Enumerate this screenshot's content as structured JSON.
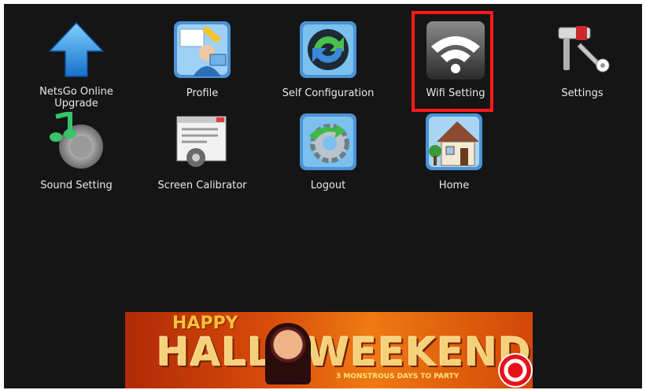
{
  "apps": [
    {
      "label": "NetsGo Online Upgrade",
      "icon": "upload-arrow-icon"
    },
    {
      "label": "Profile",
      "icon": "profile-icon"
    },
    {
      "label": "Self Configuration",
      "icon": "sync-icon"
    },
    {
      "label": "Wifi Setting",
      "icon": "wifi-icon"
    },
    {
      "label": "Settings",
      "icon": "tools-icon"
    },
    {
      "label": "Sound Setting",
      "icon": "speaker-icon"
    },
    {
      "label": "Screen Calibrator",
      "icon": "calibrator-icon"
    },
    {
      "label": "Logout",
      "icon": "logout-gear-icon"
    },
    {
      "label": "Home",
      "icon": "house-icon"
    }
  ],
  "highlighted_app": "Wifi Setting",
  "colors": {
    "background": "#151515",
    "highlight": "#ff1a1a",
    "label_text": "#e9e9e9"
  },
  "banner": {
    "happy": "HAPPY",
    "title": "HALLOWEEKEND",
    "subtitle": "3 MONSTROUS DAYS TO PARTY"
  }
}
